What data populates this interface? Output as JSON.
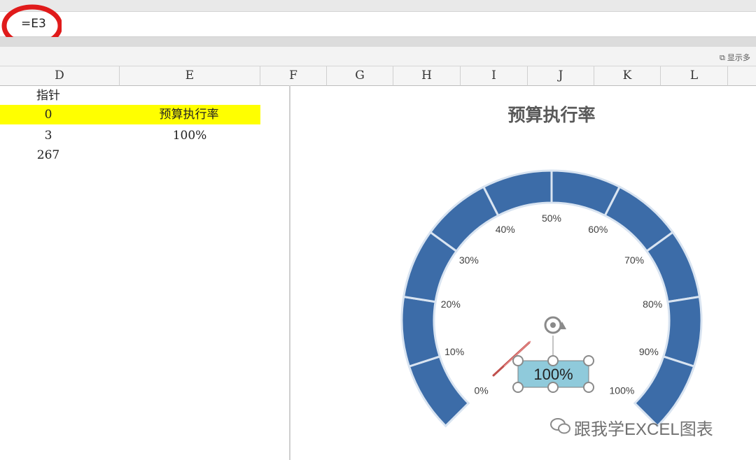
{
  "formula_bar": {
    "value": "=E3"
  },
  "toolbar": {
    "show_label": "显示多"
  },
  "columns": [
    "D",
    "E",
    "F",
    "G",
    "H",
    "I",
    "J",
    "K",
    "L"
  ],
  "cells": {
    "d1": "指针",
    "d2": "0",
    "d3": "3",
    "d4": "267",
    "e2": "预算执行率",
    "e3": "100%"
  },
  "chart": {
    "title": "预算执行率",
    "tick_labels": [
      "0%",
      "10%",
      "20%",
      "30%",
      "40%",
      "50%",
      "60%",
      "70%",
      "80%",
      "90%",
      "100%"
    ],
    "value_label": "100%",
    "segment_color": "#3c6ca8",
    "needle_color": "#c0504d",
    "textbox_color": "#8fcadb"
  },
  "chart_data": {
    "type": "doughnut",
    "title": "预算执行率",
    "segments": 10,
    "tick_labels": [
      "0%",
      "10%",
      "20%",
      "30%",
      "40%",
      "50%",
      "60%",
      "70%",
      "80%",
      "90%",
      "100%"
    ],
    "value": 1.0,
    "pointer": {
      "value": 0
    },
    "blank": 267
  },
  "watermark": {
    "text": "跟我学EXCEL图表"
  }
}
